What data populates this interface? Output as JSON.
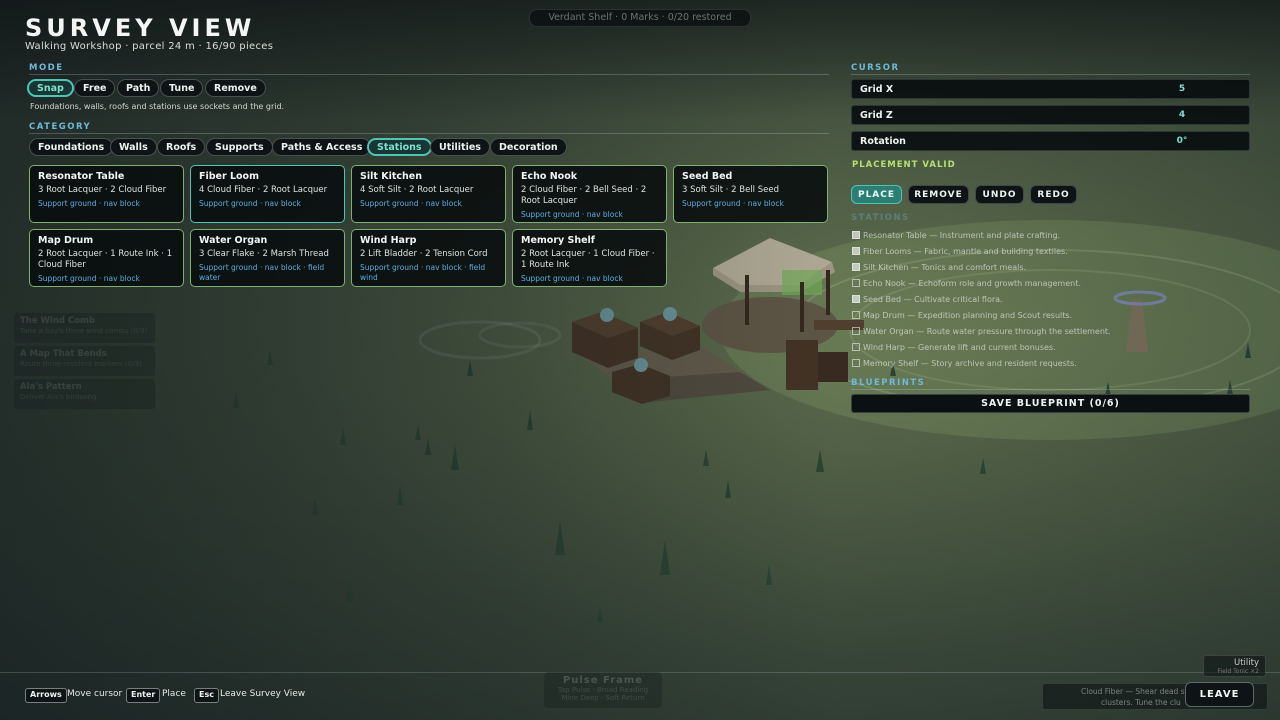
{
  "header": {
    "title": "SURVEY VIEW",
    "subtitle": "Walking Workshop · parcel 24 m · 16/90 pieces",
    "status": "Verdant Shelf · 0 Marks · 0/20 restored"
  },
  "mode": {
    "label": "MODE",
    "options": [
      "Snap",
      "Free",
      "Path",
      "Tune",
      "Remove"
    ],
    "selected": "Snap",
    "hint": "Foundations, walls, roofs and stations use sockets and the grid."
  },
  "category": {
    "label": "CATEGORY",
    "options": [
      "Foundations",
      "Walls",
      "Roofs",
      "Supports",
      "Paths & Access",
      "Stations",
      "Utilities",
      "Decoration"
    ],
    "selected": "Stations"
  },
  "pieces": [
    {
      "name": "Resonator Table",
      "cost": "3 Root Lacquer · 2 Cloud Fiber",
      "tags": "Support ground · nav block"
    },
    {
      "name": "Fiber Loom",
      "cost": "4 Cloud Fiber · 2 Root Lacquer",
      "tags": "Support ground · nav block"
    },
    {
      "name": "Silt Kitchen",
      "cost": "4 Soft Silt · 2 Root Lacquer",
      "tags": "Support ground · nav block"
    },
    {
      "name": "Echo Nook",
      "cost": "2 Cloud Fiber · 2 Bell Seed · 2 Root Lacquer",
      "tags": "Support ground · nav block"
    },
    {
      "name": "Seed Bed",
      "cost": "3 Soft Silt · 2 Bell Seed",
      "tags": "Support ground · nav block"
    },
    {
      "name": "Map Drum",
      "cost": "2 Root Lacquer · 1 Route Ink · 1 Cloud Fiber",
      "tags": "Support ground · nav block"
    },
    {
      "name": "Water Organ",
      "cost": "3 Clear Flake · 2 Marsh Thread",
      "tags": "Support ground · nav block · field water"
    },
    {
      "name": "Wind Harp",
      "cost": "2 Lift Bladder · 2 Tension Cord",
      "tags": "Support ground · nav block · field wind"
    },
    {
      "name": "Memory Shelf",
      "cost": "2 Root Lacquer · 1 Cloud Fiber · 1 Route Ink",
      "tags": "Support ground · nav block"
    }
  ],
  "quests_faded": [
    {
      "title": "The Wind Comb",
      "sub": "Tune a bay's three wind combs (0/3)"
    },
    {
      "title": "A Map That Bends",
      "sub": "Route three resident markers (0/3)"
    },
    {
      "title": "Ala's Pattern",
      "sub": "Deliver Ala's birdsong"
    }
  ],
  "cursor": {
    "label": "CURSOR",
    "rows": [
      {
        "key": "Grid X",
        "value": "5"
      },
      {
        "key": "Grid Z",
        "value": "4"
      },
      {
        "key": "Rotation",
        "value": "0°"
      }
    ],
    "placement": "PLACEMENT VALID"
  },
  "actions": [
    "PLACE",
    "REMOVE",
    "UNDO",
    "REDO"
  ],
  "stations_list": {
    "label": "STATIONS",
    "items": [
      {
        "text": "Resonator Table — Instrument and plate crafting.",
        "checked": true
      },
      {
        "text": "Fiber Looms — Fabric, mantle and building textiles.",
        "checked": true
      },
      {
        "text": "Silt Kitchen — Tonics and comfort meals.",
        "checked": true
      },
      {
        "text": "Echo Nook — Echoform role and growth management.",
        "checked": false
      },
      {
        "text": "Seed Bed — Cultivate critical flora.",
        "checked": true
      },
      {
        "text": "Map Drum — Expedition planning and Scout results.",
        "checked": false
      },
      {
        "text": "Water Organ — Route water pressure through the settlement.",
        "checked": false
      },
      {
        "text": "Wind Harp — Generate lift and current bonuses.",
        "checked": false
      },
      {
        "text": "Memory Shelf — Story archive and resident requests.",
        "checked": false
      }
    ]
  },
  "blueprints": {
    "label": "BLUEPRINTS",
    "save": "SAVE BLUEPRINT (0/6)"
  },
  "footer": {
    "hints": [
      {
        "key": "Arrows",
        "text": "Move cursor"
      },
      {
        "key": "Enter",
        "text": "Place"
      },
      {
        "key": "Esc",
        "text": "Leave Survey View"
      }
    ],
    "pulse_title": "Pulse Frame",
    "pulse_line1": "Tap Pulse · Broad Reading",
    "pulse_line2": "Mine Deep · Soft Return",
    "utility_title": "Utility",
    "utility_sub": "Field Tonic ×2",
    "tooltip_line1": "Cloud Fiber — Shear dead strands from",
    "tooltip_line2": "clusters. Tune the clu",
    "leave": "LEAVE"
  }
}
